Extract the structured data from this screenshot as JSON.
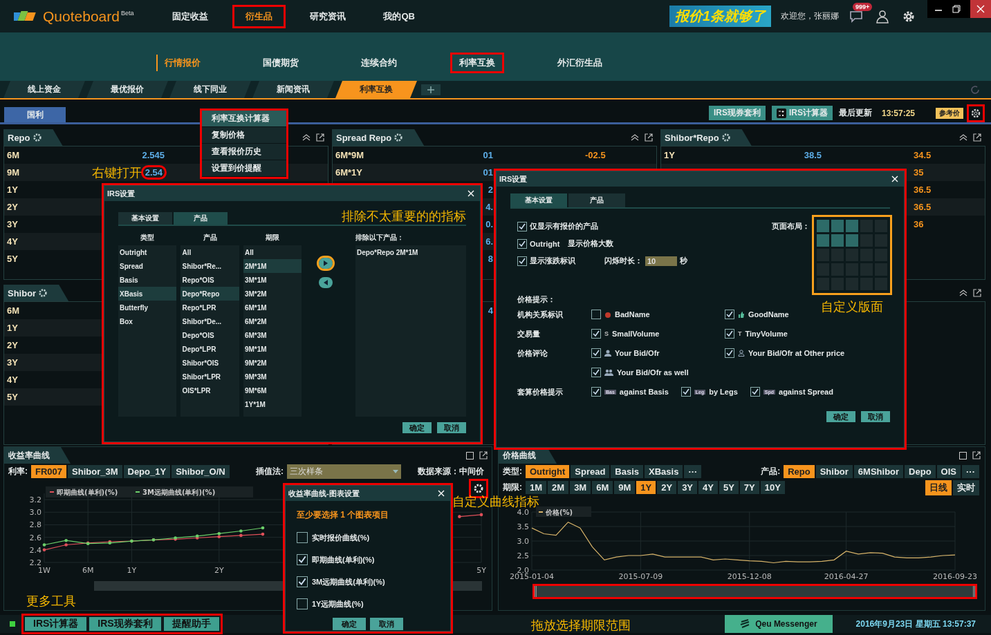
{
  "header": {
    "logo": "Quoteboard",
    "logo_sup": "Beta",
    "banner": "报价1条就够了",
    "welcome": "欢迎您，张丽娜",
    "badge": "999+",
    "nav": [
      {
        "label": "固定收益",
        "selected": false,
        "highlighted": false
      },
      {
        "label": "衍生品",
        "selected": true,
        "highlighted": true
      },
      {
        "label": "研究资讯",
        "selected": false,
        "highlighted": false
      },
      {
        "label": "我的QB",
        "selected": false,
        "highlighted": false
      }
    ]
  },
  "sub_nav": [
    {
      "label": "行情报价",
      "selected": true,
      "highlighted": false
    },
    {
      "label": "国债期货",
      "selected": false,
      "highlighted": false
    },
    {
      "label": "连续合约",
      "selected": false,
      "highlighted": false
    },
    {
      "label": "利率互换",
      "selected": false,
      "highlighted": true
    },
    {
      "label": "外汇衍生品",
      "selected": false,
      "highlighted": false
    }
  ],
  "page_tabs": [
    {
      "label": "线上资金",
      "selected": false
    },
    {
      "label": "最优报价",
      "selected": false
    },
    {
      "label": "线下同业",
      "selected": false
    },
    {
      "label": "新闻资讯",
      "selected": false
    },
    {
      "label": "利率互换",
      "selected": true
    }
  ],
  "toolbar": {
    "tab": "国利",
    "arbitrage_button": "IRS现券套利",
    "calculator_button": "IRS计算器",
    "update_label": "最后更新",
    "update_time": "13:57:25",
    "ref_badge": "参考价"
  },
  "panels": [
    {
      "title": "Repo",
      "rows": [
        {
          "term": "6M",
          "bid": "2.545"
        },
        {
          "term": "9M",
          "bid": "2.54"
        },
        {
          "term": "1Y"
        },
        {
          "term": "2Y"
        },
        {
          "term": "3Y"
        },
        {
          "term": "4Y"
        },
        {
          "term": "5Y"
        }
      ]
    },
    {
      "title": "Spread Repo",
      "rows": [
        {
          "term": "6M*9M",
          "bid": "01",
          "ofr": "-02.5"
        },
        {
          "term": "6M*1Y",
          "bid": "01"
        },
        {
          "bid": "2"
        },
        {
          "bid": "4."
        },
        {
          "bid": "0."
        },
        {
          "bid": "6."
        },
        {
          "bid": "8"
        }
      ]
    },
    {
      "title": "Shibor*Repo",
      "rows": [
        {
          "term": "1Y",
          "bid": "38.5",
          "ofr": "34.5"
        },
        {
          "ofr": "35"
        },
        {
          "ofr": "36.5"
        },
        {
          "ofr": "36.5"
        },
        {
          "ofr": "36"
        }
      ]
    },
    {
      "title": "Shibor",
      "rows": [
        {
          "term": "6M"
        },
        {
          "term": "1Y"
        },
        {
          "term": "2Y"
        },
        {
          "term": "3Y"
        },
        {
          "term": "4Y"
        },
        {
          "term": "5Y"
        }
      ]
    },
    {
      "rows": [
        {
          "bid": "4"
        }
      ]
    }
  ],
  "context_menu": {
    "annotation": "右键打开",
    "items": [
      {
        "label": "利率互换计算器",
        "selected": true
      },
      {
        "label": "复制价格",
        "selected": false
      },
      {
        "label": "查看报价历史",
        "selected": false
      },
      {
        "label": "设置到价提醒",
        "selected": false
      }
    ]
  },
  "product_dialog": {
    "title": "IRS设置",
    "annotation": "排除不太重要的的指标",
    "tabs": [
      {
        "label": "基本设置",
        "selected": false
      },
      {
        "label": "产品",
        "selected": true
      }
    ],
    "columns": [
      {
        "heading": "类型",
        "items": [
          {
            "label": "Outright",
            "selected": false
          },
          {
            "label": "Spread",
            "selected": false
          },
          {
            "label": "Basis",
            "selected": false
          },
          {
            "label": "XBasis",
            "selected": true
          },
          {
            "label": "Butterfly",
            "selected": false
          },
          {
            "label": "Box",
            "selected": false
          }
        ]
      },
      {
        "heading": "产品",
        "items": [
          {
            "label": "All",
            "selected": false
          },
          {
            "label": "Shibor*Re...",
            "selected": false
          },
          {
            "label": "Repo*OIS",
            "selected": false
          },
          {
            "label": "Depo*Repo",
            "selected": true
          },
          {
            "label": "Repo*LPR",
            "selected": false
          },
          {
            "label": "Shibor*De...",
            "selected": false
          },
          {
            "label": "Depo*OIS",
            "selected": false
          },
          {
            "label": "Depo*LPR",
            "selected": false
          },
          {
            "label": "Shibor*OIS",
            "selected": false
          },
          {
            "label": "Shibor*LPR",
            "selected": false
          },
          {
            "label": "OIS*LPR",
            "selected": false
          }
        ]
      },
      {
        "heading": "期限",
        "items": [
          {
            "label": "All",
            "selected": false
          },
          {
            "label": "2M*1M",
            "selected": true
          },
          {
            "label": "3M*1M",
            "selected": false
          },
          {
            "label": "3M*2M",
            "selected": false
          },
          {
            "label": "6M*1M",
            "selected": false
          },
          {
            "label": "6M*2M",
            "selected": false
          },
          {
            "label": "6M*3M",
            "selected": false
          },
          {
            "label": "9M*1M",
            "selected": false
          },
          {
            "label": "9M*2M",
            "selected": false
          },
          {
            "label": "9M*3M",
            "selected": false
          },
          {
            "label": "9M*6M",
            "selected": false
          },
          {
            "label": "1Y*1M",
            "selected": false
          }
        ]
      }
    ],
    "excluded_heading": "排除以下产品：",
    "excluded": [
      "Depo*Repo 2M*1M"
    ],
    "ok": "确定",
    "cancel": "取消"
  },
  "basic_dialog": {
    "title": "IRS设置",
    "annotation": "自定义版面",
    "tabs": [
      {
        "label": "基本设置",
        "selected": true
      },
      {
        "label": "产品",
        "selected": false
      }
    ],
    "options": [
      {
        "label": "仅显示有报价的产品",
        "checked": true
      },
      {
        "label": "Outright",
        "extra": "显示价格大数",
        "checked": true
      },
      {
        "label": "显示涨跌标识",
        "checked": true
      }
    ],
    "flash_label": "闪烁时长：",
    "flash_value": "10",
    "flash_unit": "秒",
    "layout_label": "页面布局：",
    "layout_grid": [
      [
        true,
        true,
        true,
        false,
        false
      ],
      [
        true,
        true,
        true,
        false,
        false
      ],
      [
        false,
        false,
        false,
        false,
        false
      ],
      [
        false,
        false,
        false,
        false,
        false
      ],
      [
        false,
        false,
        false,
        false,
        false
      ]
    ],
    "alerts_heading": "价格提示：",
    "alerts": [
      {
        "label": "机构关系标识",
        "options": [
          {
            "kind": "bad",
            "text": "BadName",
            "checked": false
          },
          {
            "kind": "good",
            "text": "GoodName",
            "checked": true
          }
        ]
      },
      {
        "label": "交易量",
        "options": [
          {
            "kind": "letter",
            "mark": "S",
            "text": "SmallVolume",
            "checked": true
          },
          {
            "kind": "letter",
            "mark": "T",
            "text": "TinyVolume",
            "checked": true
          }
        ]
      },
      {
        "label": "价格评论",
        "options": [
          {
            "kind": "person",
            "text": "Your Bid/Ofr",
            "checked": true
          },
          {
            "kind": "person-outline",
            "text": "Your Bid/Ofr at Other price",
            "checked": true
          }
        ]
      },
      {
        "options": [
          {
            "kind": "people",
            "text": "Your Bid/Ofr as well",
            "checked": true
          }
        ]
      },
      {
        "label": "套算价格提示",
        "options": [
          {
            "kind": "tag",
            "mark": "Bas",
            "text": "against Basis",
            "checked": true
          },
          {
            "kind": "tag",
            "mark": "Leg",
            "text": "by Legs",
            "checked": true
          },
          {
            "kind": "tag",
            "mark": "Spd",
            "text": "against Spread",
            "checked": true
          }
        ]
      }
    ],
    "ok": "确定",
    "cancel": "取消"
  },
  "yield_curve": {
    "title": "收益率曲线",
    "rate_label": "利率:",
    "rates": [
      {
        "label": "FR007",
        "selected": true
      },
      {
        "label": "Shibor_3M",
        "selected": false
      },
      {
        "label": "Depo_1Y",
        "selected": false
      },
      {
        "label": "Shibor_O/N",
        "selected": false
      }
    ],
    "interp_label": "插值法:",
    "interp_value": "三次样条",
    "source": "数据来源：中间价",
    "annotation": "更多工具",
    "chart_data": {
      "type": "line",
      "grid": true,
      "legend": true,
      "categories": [
        "1W",
        null,
        "6M",
        null,
        "1Y",
        null,
        null,
        null,
        "2Y",
        null,
        null,
        null,
        null,
        null,
        null,
        null,
        null,
        null,
        null,
        null,
        "5Y"
      ],
      "ylim": [
        2.2,
        3.3
      ],
      "yticks": [
        {
          "value": 2.2,
          "label": "2.2"
        },
        {
          "value": 2.4,
          "label": "2.4"
        },
        {
          "value": 2.6,
          "label": "2.6"
        },
        {
          "value": 2.8,
          "label": "2.8"
        },
        {
          "value": 3.0,
          "label": "3.0"
        },
        {
          "value": 3.2,
          "label": "3.2"
        }
      ],
      "series": [
        {
          "name": "即期曲线(单利)(%)",
          "color": "#e0505a",
          "values": [
            2.4,
            2.48,
            2.51,
            2.53,
            2.54,
            2.56,
            2.57,
            2.59,
            2.61,
            2.63,
            2.65,
            null,
            null,
            null,
            null,
            null,
            null,
            null,
            null,
            2.93,
            2.96
          ]
        },
        {
          "name": "3M远期曲线(单利)(%)",
          "color": "#6ccf6a",
          "values": [
            2.48,
            2.55,
            2.5,
            2.51,
            2.54,
            2.56,
            2.59,
            2.62,
            2.66,
            2.7,
            2.75,
            null,
            null,
            null,
            null,
            null,
            null,
            null,
            null,
            null,
            null
          ]
        }
      ]
    },
    "settings": {
      "title": "收益率曲线-图表设置",
      "warning": "至少要选择 1 个图表项目",
      "annotation": "自定义曲线指标",
      "items": [
        {
          "label": "实时报价曲线(%)",
          "checked": false
        },
        {
          "label": "即期曲线(单利)(%)",
          "checked": true
        },
        {
          "label": "3M远期曲线(单利)(%)",
          "checked": true
        },
        {
          "label": "1Y远期曲线(%)",
          "checked": false
        }
      ],
      "ok": "确定",
      "cancel": "取消"
    }
  },
  "price_curve": {
    "title": "价格曲线",
    "type_label": "类型:",
    "types": [
      {
        "label": "Outright",
        "selected": true
      },
      {
        "label": "Spread",
        "selected": false
      },
      {
        "label": "Basis",
        "selected": false
      },
      {
        "label": "XBasis",
        "selected": false
      }
    ],
    "types_more": "···",
    "product_label": "产品:",
    "products": [
      {
        "label": "Repo",
        "selected": true
      },
      {
        "label": "Shibor",
        "selected": false
      },
      {
        "label": "6MShibor",
        "selected": false
      },
      {
        "label": "Depo",
        "selected": false
      },
      {
        "label": "OIS",
        "selected": false
      }
    ],
    "products_more": "···",
    "term_label": "期限:",
    "terms": [
      {
        "label": "1M",
        "selected": false
      },
      {
        "label": "2M",
        "selected": false
      },
      {
        "label": "3M",
        "selected": false
      },
      {
        "label": "6M",
        "selected": false
      },
      {
        "label": "9M",
        "selected": false
      },
      {
        "label": "1Y",
        "selected": true
      },
      {
        "label": "2Y",
        "selected": false
      },
      {
        "label": "3Y",
        "selected": false
      },
      {
        "label": "4Y",
        "selected": false
      },
      {
        "label": "5Y",
        "selected": false
      },
      {
        "label": "7Y",
        "selected": false
      },
      {
        "label": "10Y",
        "selected": false
      }
    ],
    "modes": [
      {
        "label": "日线",
        "selected": true
      },
      {
        "label": "实时",
        "selected": false
      }
    ],
    "chart_data": {
      "type": "line",
      "grid": true,
      "legend": true,
      "categories": [
        "2015-01-04",
        null,
        null,
        null,
        null,
        null,
        null,
        null,
        null,
        "2015-07-09",
        null,
        null,
        null,
        null,
        null,
        null,
        null,
        null,
        "2015-12-08",
        null,
        null,
        null,
        null,
        null,
        null,
        null,
        "2016-04-27",
        null,
        null,
        null,
        null,
        null,
        null,
        null,
        null,
        "2016-09-23"
      ],
      "ylim": [
        2.0,
        4.0
      ],
      "yticks": [
        {
          "value": 2.0,
          "label": "2.0"
        },
        {
          "value": 2.5,
          "label": "2.5"
        },
        {
          "value": 3.0,
          "label": "3.0"
        },
        {
          "value": 3.5,
          "label": "3.5"
        },
        {
          "value": 4.0,
          "label": "4.0"
        }
      ],
      "series": [
        {
          "name": "价格(%)",
          "color": "#d8b46a",
          "values": [
            3.45,
            3.25,
            3.2,
            3.65,
            3.45,
            2.8,
            2.35,
            2.45,
            2.5,
            2.5,
            2.55,
            2.45,
            2.45,
            2.45,
            2.45,
            2.35,
            2.38,
            2.35,
            2.32,
            2.3,
            2.25,
            2.3,
            2.28,
            2.28,
            2.3,
            2.35,
            2.65,
            2.55,
            2.6,
            2.58,
            2.45,
            2.42,
            2.42,
            2.45,
            2.5,
            2.52
          ]
        }
      ]
    },
    "range_slider": {
      "level": 1
    },
    "annotation": "拖放选择期限范围"
  },
  "status_bar": {
    "tools": [
      "IRS计算器",
      "IRS现券套利",
      "提醒助手"
    ],
    "messenger": "Qeu Messenger",
    "datetime": "2016年9月23日 星期五 13:57:37"
  }
}
